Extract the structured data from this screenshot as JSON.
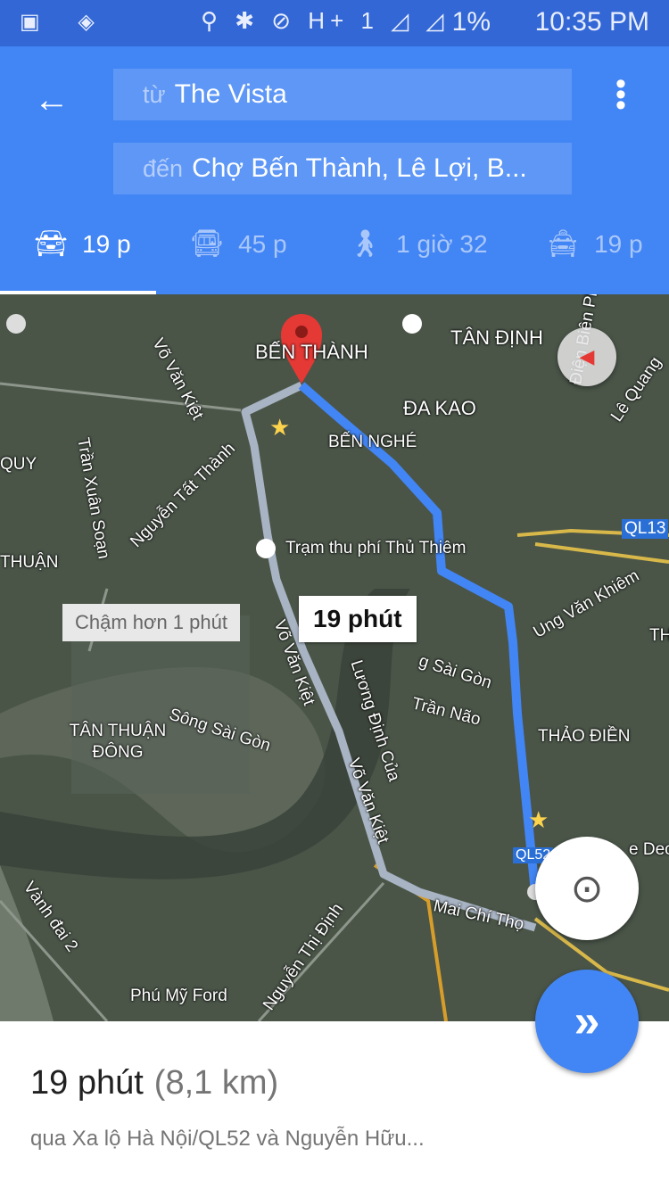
{
  "status_bar": {
    "battery": "1%",
    "time": "10:35 PM",
    "network": "H+",
    "sim": "1"
  },
  "header": {
    "from_prefix": "từ",
    "from_value": "The Vista",
    "to_prefix": "đến",
    "to_value": "Chợ Bến Thành, Lê Lợi, B...",
    "modes": [
      {
        "icon": "car-icon",
        "label": "19 p",
        "active": true
      },
      {
        "icon": "bus-icon",
        "label": "45 p"
      },
      {
        "icon": "walk-icon",
        "label": "1 giờ 32"
      },
      {
        "icon": "taxi-icon",
        "label": "19 p"
      }
    ]
  },
  "map": {
    "type": "satellite",
    "route_color": "#4285f4",
    "alt_route_color": "#a8b4c4",
    "labels": [
      "Võ Văn Kiệt",
      "BẾN THÀNH",
      "TÂN ĐỊNH",
      "ĐA KAO",
      "BẾN NGHÉ",
      "Trần Xuân Soạn",
      "Nguyễn Tất Thành",
      "QUY",
      "THUẬN",
      "Trạm thu phí Thủ Thiêm",
      "QL13",
      "Ung Văn Khiêm",
      "Sông Sài Gòn",
      "Trần Não",
      "Lương Định Của",
      "THẢO ĐIỀN",
      "TÂN THUẬN ĐÔNG",
      "Võ Văn Kiệt",
      "Võ Văn Kiệt",
      "Vành đai 2",
      "Mai Chí Thọ",
      "Nguyễn Thị Định",
      "Phú Mỹ Ford",
      "QL52",
      "Lê Quang",
      "Điện Biên Phủ",
      "g Sài Gòn",
      "e Dec",
      "TH"
    ],
    "primary_callout": "19 phút",
    "alt_callout": "Chậm hơn 1 phút"
  },
  "summary": {
    "duration": "19 phút",
    "distance": "(8,1 km)",
    "via": "qua Xa lộ Hà Nội/QL52 và Nguyễn Hữu..."
  }
}
